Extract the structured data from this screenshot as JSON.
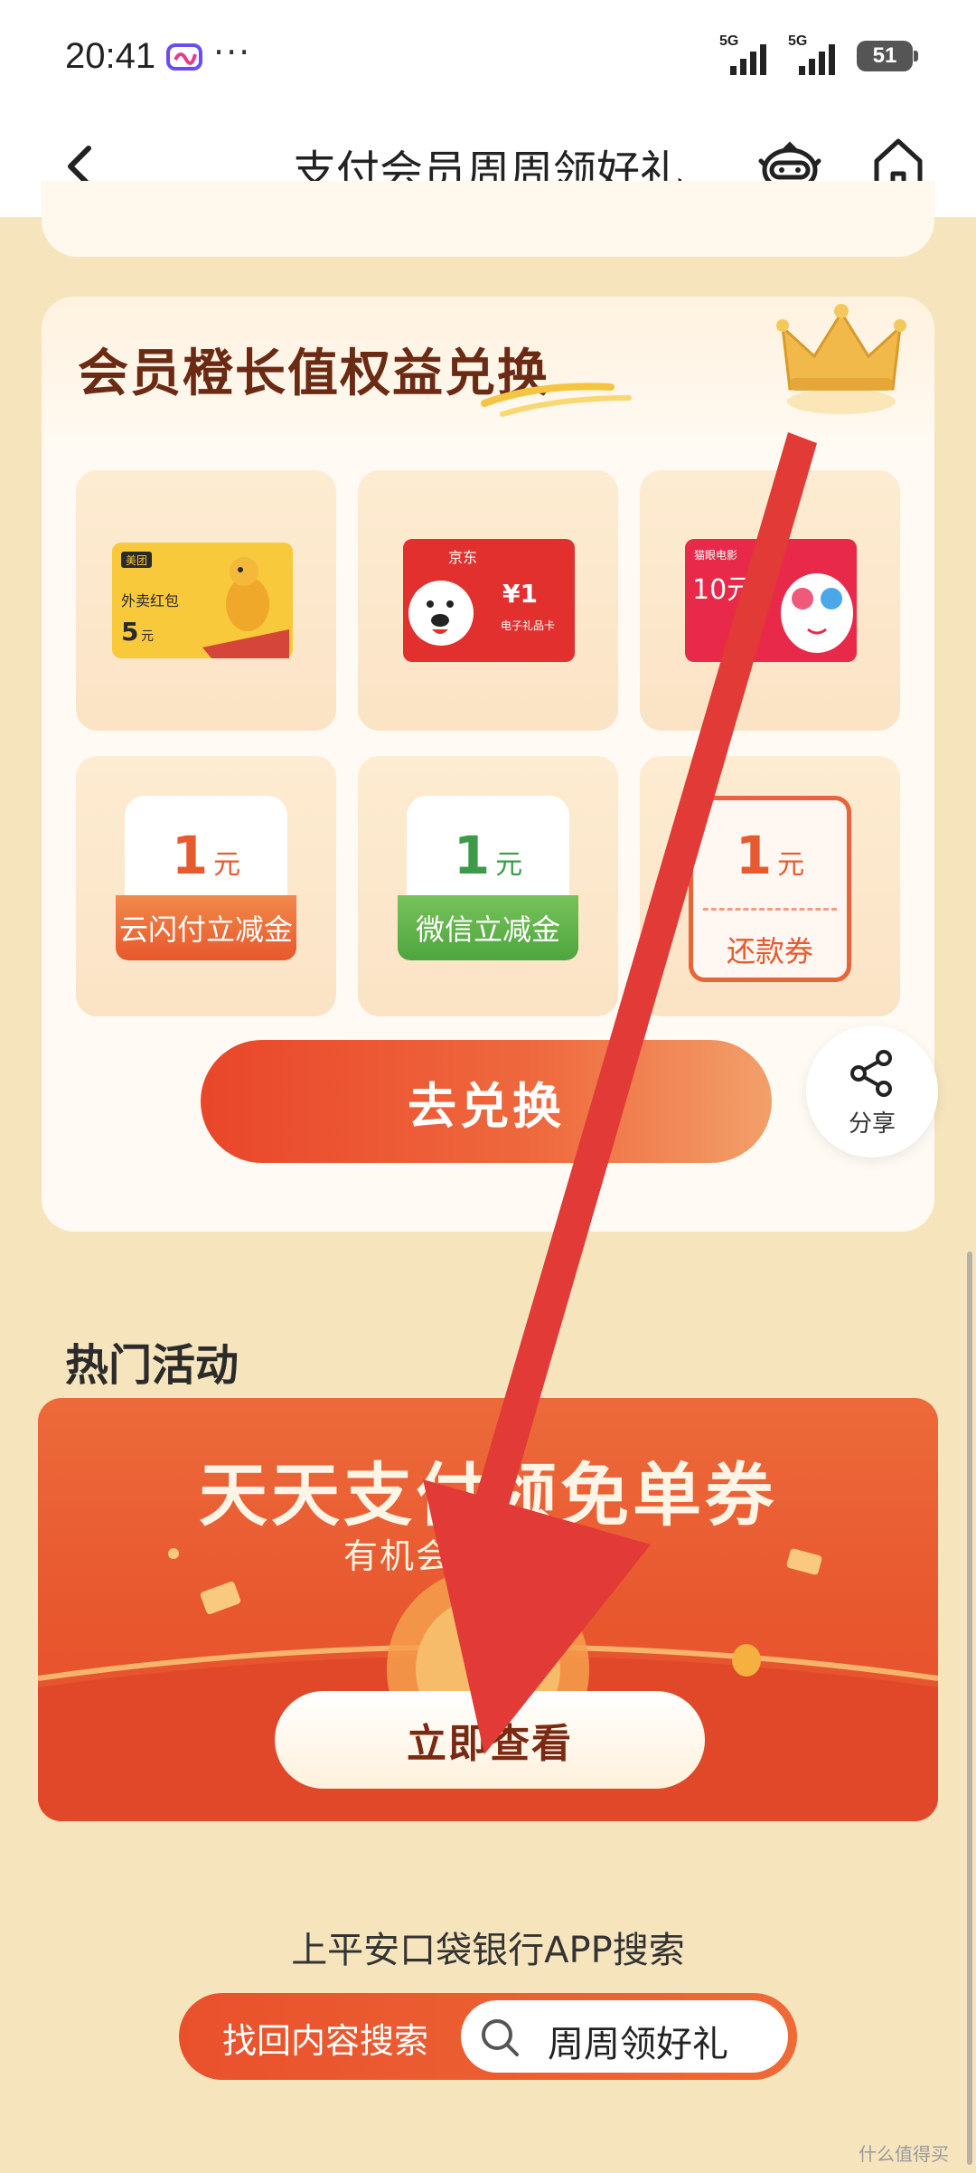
{
  "status_bar": {
    "time": "20:41",
    "more": "···",
    "network_1": "5G",
    "network_2": "5G",
    "battery": "51"
  },
  "nav": {
    "title": "支付会员周周领好礼"
  },
  "exchange": {
    "title": "会员橙长值权益兑换",
    "products": [
      {
        "brand": "美团",
        "name": "外卖红包",
        "amount": "5",
        "unit": "元"
      },
      {
        "brand": "京东",
        "amount": "¥1",
        "name": "电子礼品卡"
      },
      {
        "brand": "猫眼电影",
        "amount": "10元"
      }
    ],
    "coupons": [
      {
        "amount": "1",
        "unit": "元",
        "name": "云闪付立减金"
      },
      {
        "amount": "1",
        "unit": "元",
        "name": "微信立减金"
      },
      {
        "amount": "1",
        "unit": "元",
        "name": "还款券"
      }
    ],
    "button": "去兑换"
  },
  "share": {
    "label": "分享"
  },
  "hot": {
    "title": "热门活动",
    "banner_title": "天天支付领免单券",
    "banner_sub": "有机会享…元免单",
    "button": "立即查看"
  },
  "search": {
    "hint": "上平安口袋银行APP搜索",
    "label": "找回内容搜索",
    "keyword": "周周领好礼"
  },
  "watermark": "什么值得买",
  "colors": {
    "page_bg": "#f6e4bd",
    "accent": "#e9512c",
    "arrow": "#e23a36"
  }
}
